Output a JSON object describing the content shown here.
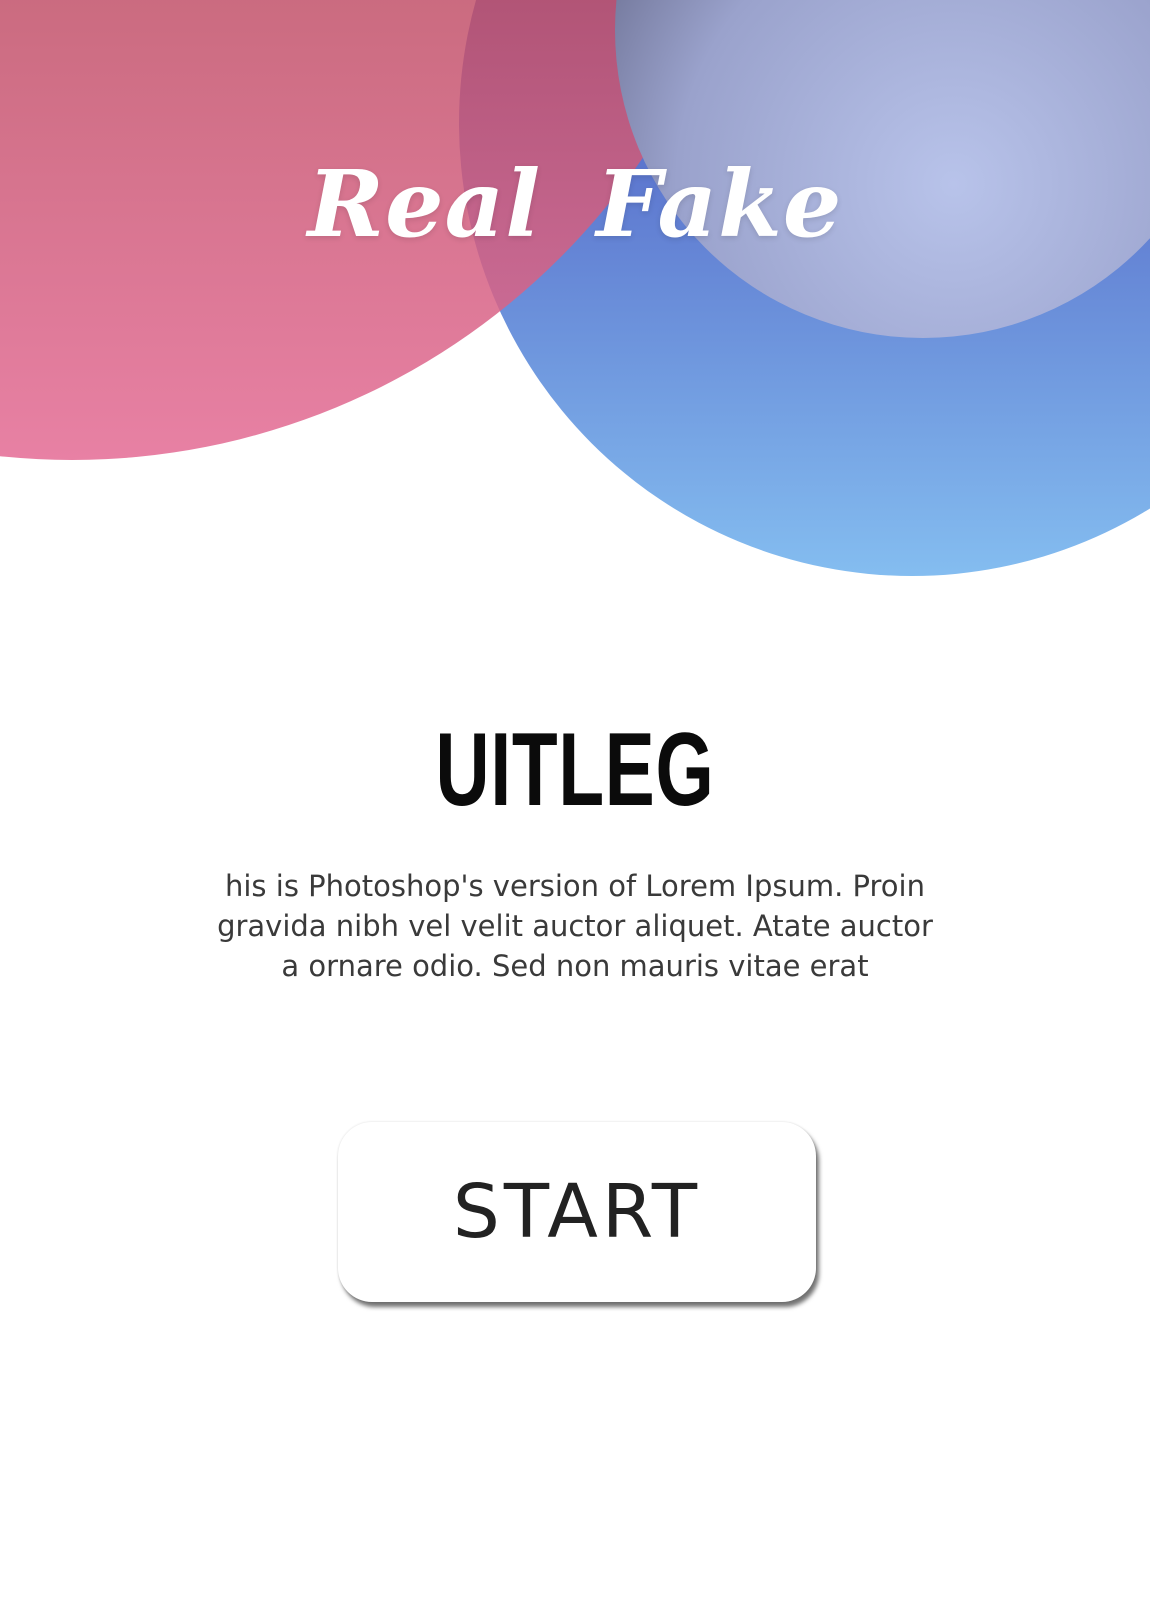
{
  "header": {
    "logo_text": "Real Fake"
  },
  "main": {
    "title": "UITLEG",
    "description_lines": [
      "his is Photoshop's version  of Lorem Ipsum. Proin",
      "gravida nibh vel velit auctor aliquet. Atate  auctor",
      "a ornare odio. Sed non  mauris vitae erat"
    ],
    "start_label": "START"
  },
  "colors": {
    "red_circle_top": "#8a3a40",
    "red_circle_bottom": "#e46c95",
    "blue_circle_top": "#4a56b8",
    "blue_circle_bottom": "#84bdf0",
    "light_circle": "#b3bde6",
    "title": "#0b0b0b",
    "text": "#3a3a3a",
    "background": "#ffffff"
  }
}
